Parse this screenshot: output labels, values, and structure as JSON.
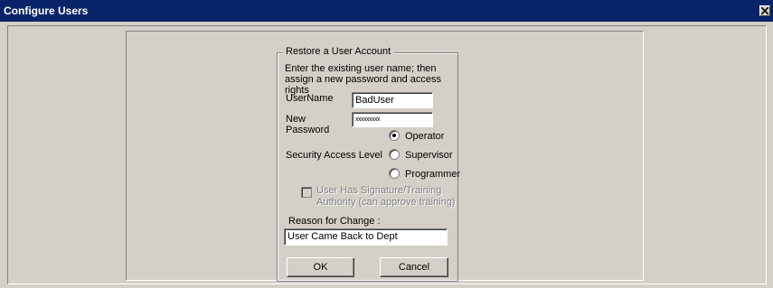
{
  "window": {
    "title": "Configure Users",
    "close_icon": "close-icon"
  },
  "group": {
    "title": "Restore a User Account",
    "instructions": "Enter the existing user name; then assign a new password and access rights"
  },
  "fields": {
    "username_label": "UserName",
    "username_value": "BadUser",
    "new_password_label_line1": "New",
    "new_password_label_line2": "Password",
    "new_password_value": "xxxxxxxxx"
  },
  "security": {
    "label": "Security Access Level",
    "options": [
      "Operator",
      "Supervisor",
      "Programmer"
    ],
    "selected": "Operator"
  },
  "signature": {
    "line1": "User Has Signature/Training",
    "line2": "Authority (can approve training)",
    "checked": false,
    "enabled": false
  },
  "reason": {
    "label": "Reason for Change :",
    "value": "User Came Back to Dept"
  },
  "buttons": {
    "ok": "OK",
    "cancel": "Cancel"
  }
}
